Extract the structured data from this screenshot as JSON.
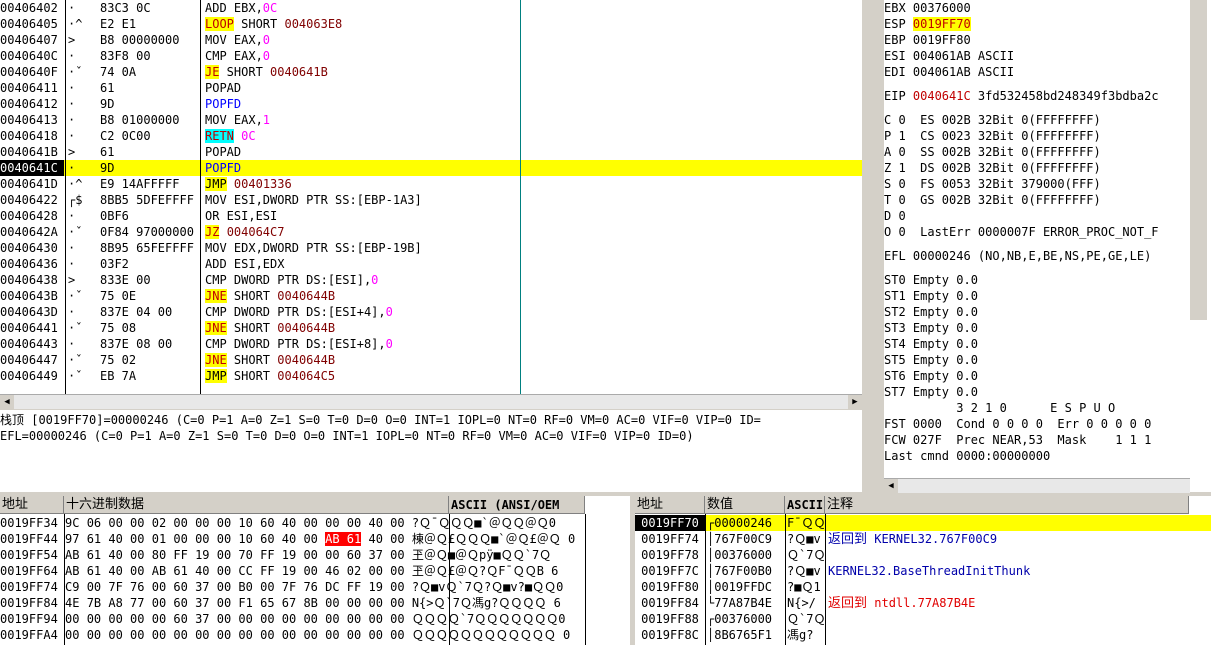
{
  "disasm": {
    "rows": [
      {
        "addr": "00406402",
        "mk": "·",
        "hex": "83C3 0C",
        "dis": [
          {
            "t": "ADD EBX,"
          },
          {
            "t": "0C",
            "c": "imm"
          }
        ]
      },
      {
        "addr": "00406405",
        "mk": "·^",
        "hex": "E2 E1",
        "dis": [
          {
            "t": "LOOP",
            "c": "kw-loop"
          },
          {
            "t": " SHORT "
          },
          {
            "t": "004063E8",
            "c": "tgt"
          }
        ]
      },
      {
        "addr": "00406407",
        "mk": ">",
        "hex": "B8 00000000",
        "dis": [
          {
            "t": "MOV EAX,"
          },
          {
            "t": "0",
            "c": "imm"
          }
        ]
      },
      {
        "addr": "0040640C",
        "mk": "·",
        "hex": "83F8 00",
        "dis": [
          {
            "t": "CMP EAX,"
          },
          {
            "t": "0",
            "c": "imm"
          }
        ]
      },
      {
        "addr": "0040640F",
        "mk": "·ˇ",
        "hex": "74 0A",
        "dis": [
          {
            "t": "JE",
            "c": "kw-jcc"
          },
          {
            "t": " SHORT "
          },
          {
            "t": "0040641B",
            "c": "tgt"
          }
        ]
      },
      {
        "addr": "00406411",
        "mk": "·",
        "hex": "61",
        "dis": [
          {
            "t": "POPAD"
          }
        ]
      },
      {
        "addr": "00406412",
        "mk": "·",
        "hex": "9D",
        "dis": [
          {
            "t": "POPFD",
            "c": "kw-push"
          }
        ]
      },
      {
        "addr": "00406413",
        "mk": "·",
        "hex": "B8 01000000",
        "dis": [
          {
            "t": "MOV EAX,"
          },
          {
            "t": "1",
            "c": "imm"
          }
        ]
      },
      {
        "addr": "00406418",
        "mk": "·",
        "hex": "C2 0C00",
        "dis": [
          {
            "t": "RETN",
            "c": "kw-ret"
          },
          {
            "t": " "
          },
          {
            "t": "0C",
            "c": "imm"
          }
        ]
      },
      {
        "addr": "0040641B",
        "mk": ">",
        "hex": "61",
        "dis": [
          {
            "t": "POPAD"
          }
        ]
      },
      {
        "addr": "0040641C",
        "mk": "·",
        "hex": "9D",
        "dis": [
          {
            "t": "POPFD",
            "c": "kw-push"
          }
        ],
        "sel": true
      },
      {
        "addr": "0040641D",
        "mk": "·^",
        "hex": "E9 14AFFFFF",
        "dis": [
          {
            "t": "JMP",
            "c": "kw-jmp"
          },
          {
            "t": " "
          },
          {
            "t": "00401336",
            "c": "tgt"
          }
        ]
      },
      {
        "addr": "00406422",
        "mk": "┌$",
        "hex": "8BB5 5DFEFFFF",
        "dis": [
          {
            "t": "MOV ESI,DWORD PTR SS:[EBP-1A3]"
          }
        ]
      },
      {
        "addr": "00406428",
        "mk": "·",
        "hex": "0BF6",
        "dis": [
          {
            "t": "OR ESI,ESI"
          }
        ]
      },
      {
        "addr": "0040642A",
        "mk": "·ˇ",
        "hex": "0F84 97000000",
        "dis": [
          {
            "t": "JZ",
            "c": "kw-jcc"
          },
          {
            "t": " "
          },
          {
            "t": "004064C7",
            "c": "tgt"
          }
        ]
      },
      {
        "addr": "00406430",
        "mk": "·",
        "hex": "8B95 65FEFFFF",
        "dis": [
          {
            "t": "MOV EDX,DWORD PTR SS:[EBP-19B]"
          }
        ]
      },
      {
        "addr": "00406436",
        "mk": "·",
        "hex": "03F2",
        "dis": [
          {
            "t": "ADD ESI,EDX"
          }
        ]
      },
      {
        "addr": "00406438",
        "mk": ">",
        "hex": "833E 00",
        "dis": [
          {
            "t": "CMP DWORD PTR DS:[ESI],"
          },
          {
            "t": "0",
            "c": "imm"
          }
        ]
      },
      {
        "addr": "0040643B",
        "mk": "·ˇ",
        "hex": "75 0E",
        "dis": [
          {
            "t": "JNE",
            "c": "kw-jcc"
          },
          {
            "t": " SHORT "
          },
          {
            "t": "0040644B",
            "c": "tgt"
          }
        ]
      },
      {
        "addr": "0040643D",
        "mk": "·",
        "hex": "837E 04 00",
        "dis": [
          {
            "t": "CMP DWORD PTR DS:[ESI+4],"
          },
          {
            "t": "0",
            "c": "imm"
          }
        ]
      },
      {
        "addr": "00406441",
        "mk": "·ˇ",
        "hex": "75 08",
        "dis": [
          {
            "t": "JNE",
            "c": "kw-jcc"
          },
          {
            "t": " SHORT "
          },
          {
            "t": "0040644B",
            "c": "tgt"
          }
        ]
      },
      {
        "addr": "00406443",
        "mk": "·",
        "hex": "837E 08 00",
        "dis": [
          {
            "t": "CMP DWORD PTR DS:[ESI+8],"
          },
          {
            "t": "0",
            "c": "imm"
          }
        ]
      },
      {
        "addr": "00406447",
        "mk": "·ˇ",
        "hex": "75 02",
        "dis": [
          {
            "t": "JNE",
            "c": "kw-jcc"
          },
          {
            "t": " SHORT "
          },
          {
            "t": "0040644B",
            "c": "tgt"
          }
        ]
      },
      {
        "addr": "00406449",
        "mk": "·ˇ",
        "hex": "EB 7A",
        "dis": [
          {
            "t": "JMP",
            "c": "kw-jmp"
          },
          {
            "t": " SHORT "
          },
          {
            "t": "004064C5",
            "c": "tgt"
          }
        ]
      }
    ]
  },
  "info": {
    "line1": "栈顶 [0019FF70]=00000246 (C=0 P=1 A=0 Z=1 S=0 T=0 D=0 O=0 INT=1 IOPL=0 NT=0 RF=0 VM=0 AC=0 VIF=0 VIP=0 ID=",
    "line2": "EFL=00000246 (C=0 P=1 A=0 Z=1 S=0 T=0 D=0 O=0 INT=1 IOPL=0 NT=0 RF=0 VM=0 AC=0 VIF=0 VIP=0 ID=0)"
  },
  "regs": {
    "ebx": "EBX 00376000",
    "esp_label": "ESP ",
    "esp_value": "0019FF70",
    "ebp": "EBP 0019FF80",
    "esi": "ESI 004061AB ASCII",
    "edi": "EDI 004061AB ASCII",
    "eip_label": "EIP ",
    "eip_value": "0040641C",
    "eip_rest": " 3fd532458bd248349f3bdba2c",
    "seg": [
      "C 0  ES 002B 32Bit 0(FFFFFFFF)",
      "P 1  CS 0023 32Bit 0(FFFFFFFF)",
      "A 0  SS 002B 32Bit 0(FFFFFFFF)",
      "Z 1  DS 002B 32Bit 0(FFFFFFFF)",
      "S 0  FS 0053 32Bit 379000(FFF)",
      "T 0  GS 002B 32Bit 0(FFFFFFFF)",
      "D 0",
      "O 0  LastErr 0000007F ERROR_PROC_NOT_F"
    ],
    "efl": "EFL 00000246 (NO,NB,E,BE,NS,PE,GE,LE)",
    "st": [
      "ST0 Empty 0.0",
      "ST1 Empty 0.0",
      "ST2 Empty 0.0",
      "ST3 Empty 0.0",
      "ST4 Empty 0.0",
      "ST5 Empty 0.0",
      "ST6 Empty 0.0",
      "ST7 Empty 0.0"
    ],
    "fpu_hdr": "          3 2 1 0      E S P U O",
    "fst": "FST 0000  Cond 0 0 0 0  Err 0 0 0 0 0",
    "fcw": "FCW 027F  Prec NEAR,53  Mask    1 1 1",
    "last": "Last cmnd 0000:00000000"
  },
  "dump": {
    "hdr_addr": "地址",
    "hdr_hex": "十六进制数据",
    "hdr_ascii": "ASCII (ANSI/OEM",
    "rows": [
      {
        "a": "0019FF34",
        "h1": "9C 06 00 00 02 00 00 00 10 60 40 00 00 00 40 00",
        "s": "?Ｑ¯ＱＱＱ■`＠ＱＱ＠Ｑ0"
      },
      {
        "a": "0019FF44",
        "h1": "97 61 40 00 01 00 00 00 10 60 40 00 ",
        "hl": "AB 61",
        "h2": " 40 00",
        "s": "棟＠Ｑ£ＱＱＱ■`＠Ｑ£＠Ｑ 0"
      },
      {
        "a": "0019FF54",
        "h1": "AB 61 40 00 80 FF 19 00 70 FF 19 00 00 60 37 00",
        "s": "玊＠Ｑ■＠Ｑpÿ■ＱＱ`7Ｑ"
      },
      {
        "a": "0019FF64",
        "h1": "AB 61 40 00 AB 61 40 00 CC FF 19 00 46 02 00 00",
        "s": "玊＠Ｑ£＠Ｑ?ＱF¯ＱＱB 6"
      },
      {
        "a": "0019FF74",
        "h1": "C9 00 7F 76 00 60 37 00 B0 00 7F 76 DC FF 19 00",
        "s": "?Ｑ■vＱ`7Ｑ?Ｑ■v?■ＱＱ0"
      },
      {
        "a": "0019FF84",
        "h1": "4E 7B A8 77 00 60 37 00 F1 65 67 8B 00 00 00 00",
        "s": "N{>Ｑ`7Ｑ馮g?ＱＱＱＱ 6"
      },
      {
        "a": "0019FF94",
        "h1": "00 00 00 00 00 60 37 00 00 00 00 00 00 00 00 00",
        "s": "ＱＱＱＱ`7ＱＱＱＱＱＱＱ0"
      },
      {
        "a": "0019FFA4",
        "h1": "00 00 00 00 00 00 00 00 00 00 00 00 00 00 00 00",
        "s": "ＱＱＱＱＱＱＱＱＱＱＱＱ 0"
      }
    ]
  },
  "stack": {
    "hdr_addr": "地址",
    "hdr_val": "数值",
    "hdr_ascii": "ASCII",
    "hdr_comment": "注释",
    "rows": [
      {
        "a": "0019FF70",
        "v": "┌00000246",
        "s": "F¯ＱＱ",
        "c": "",
        "sel": true
      },
      {
        "a": "0019FF74",
        "v": "│767F00C9",
        "s": "?Ｑ■v",
        "c1": "返回到",
        "c2": " KERNEL32.767F00C9",
        "cc": "blue-txt"
      },
      {
        "a": "0019FF78",
        "v": "│00376000",
        "s": "Ｑ`7Ｑ",
        "c": ""
      },
      {
        "a": "0019FF7C",
        "v": "│767F00B0",
        "s": "?Ｑ■v",
        "c2": "KERNEL32.BaseThreadInitThunk",
        "cc": "blue-txt"
      },
      {
        "a": "0019FF80",
        "v": "│0019FFDC",
        "s": "?■Ｑ1",
        "c": ""
      },
      {
        "a": "0019FF84",
        "v": "└77A87B4E",
        "s": "N{>/",
        "c1": "返回到",
        "c2": " ntdll.77A87B4E",
        "cc": "red-txt"
      },
      {
        "a": "0019FF88",
        "v": "┌00376000",
        "s": "Ｑ`7Ｑ",
        "c": ""
      },
      {
        "a": "0019FF8C",
        "v": "│8B6765F1",
        "s": "馮g?",
        "c": ""
      }
    ]
  }
}
